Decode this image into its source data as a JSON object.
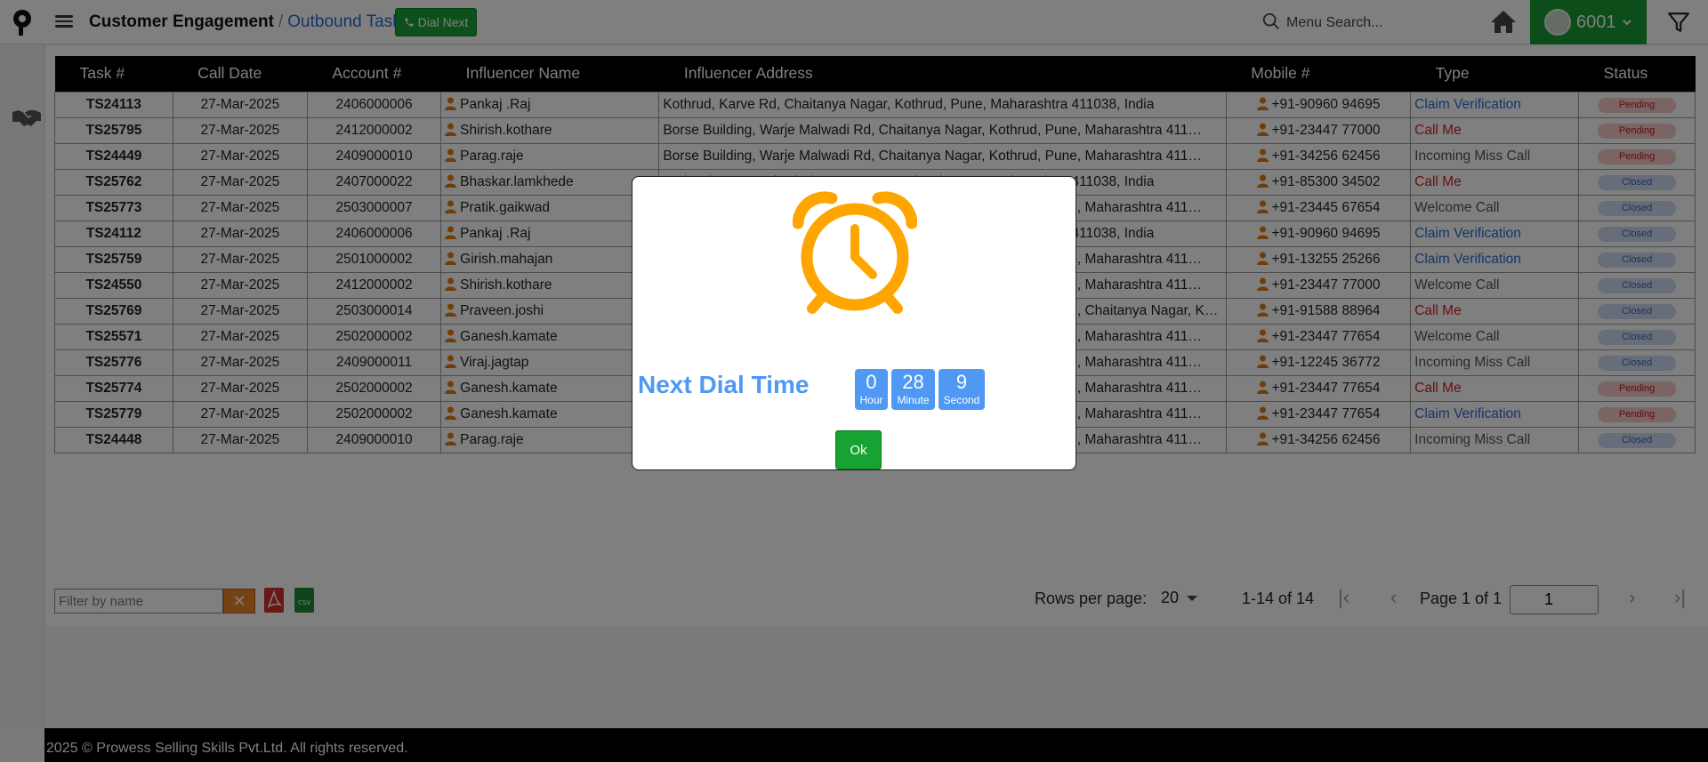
{
  "header": {
    "breadcrumb_root": "Customer Engagement",
    "breadcrumb_separator": "/",
    "breadcrumb_current": "Outbound Task",
    "dial_next_label": "Dial Next",
    "search_placeholder": "Menu Search...",
    "user_id": "6001"
  },
  "table": {
    "columns": [
      "Task #",
      "Call Date",
      "Account #",
      "Influencer Name",
      "Influencer Address",
      "Mobile #",
      "Type",
      "Status"
    ],
    "rows": [
      {
        "task": "TS24113",
        "date": "27-Mar-2025",
        "account": "2406000006",
        "name": "Pankaj .Raj",
        "address": "Kothrud, Karve Rd, Chaitanya Nagar, Kothrud, Pune, Maharashtra 411038, India",
        "mobile": "+91-90960 94695",
        "type": "Claim Verification",
        "type_color": "blue",
        "status": "Pending"
      },
      {
        "task": "TS25795",
        "date": "27-Mar-2025",
        "account": "2412000002",
        "name": "Shirish.kothare",
        "address": "Borse Building, Warje Malwadi Rd, Chaitanya Nagar, Kothrud, Pune, Maharashtra 411…",
        "mobile": "+91-23447 77000",
        "type": "Call Me",
        "type_color": "red",
        "status": "Pending"
      },
      {
        "task": "TS24449",
        "date": "27-Mar-2025",
        "account": "2409000010",
        "name": "Parag.raje",
        "address": "Borse Building, Warje Malwadi Rd, Chaitanya Nagar, Kothrud, Pune, Maharashtra 411…",
        "mobile": "+91-34256 62456",
        "type": "Incoming Miss Call",
        "type_color": "gray",
        "status": "Pending"
      },
      {
        "task": "TS25762",
        "date": "27-Mar-2025",
        "account": "2407000022",
        "name": "Bhaskar.lamkhede",
        "address": "Kothrud, Karve Rd, Chaitanya Nagar, Kothrud, Pune, Maharashtra 411038, India",
        "mobile": "+91-85300 34502",
        "type": "Call Me",
        "type_color": "red",
        "status": "Closed"
      },
      {
        "task": "TS25773",
        "date": "27-Mar-2025",
        "account": "2503000007",
        "name": "Pratik.gaikwad",
        "address": "Borse Building, Warje Malwadi Rd, Chaitanya Nagar, Kothrud, Pune, Maharashtra 411…",
        "mobile": "+91-23445 67654",
        "type": "Welcome Call",
        "type_color": "gray",
        "status": "Closed"
      },
      {
        "task": "TS24112",
        "date": "27-Mar-2025",
        "account": "2406000006",
        "name": "Pankaj .Raj",
        "address": "Kothrud, Karve Rd, Chaitanya Nagar, Kothrud, Pune, Maharashtra 411038, India",
        "mobile": "+91-90960 94695",
        "type": "Claim Verification",
        "type_color": "blue",
        "status": "Closed"
      },
      {
        "task": "TS25759",
        "date": "27-Mar-2025",
        "account": "2501000002",
        "name": "Girish.mahajan",
        "address": "Borse Building, Warje Malwadi Rd, Chaitanya Nagar, Kothrud, Pune, Maharashtra 411…",
        "mobile": "+91-13255 25266",
        "type": "Claim Verification",
        "type_color": "blue",
        "status": "Closed"
      },
      {
        "task": "TS24550",
        "date": "27-Mar-2025",
        "account": "2412000002",
        "name": "Shirish.kothare",
        "address": "Borse Building, Warje Malwadi Rd, Chaitanya Nagar, Kothrud, Pune, Maharashtra 411…",
        "mobile": "+91-23447 77000",
        "type": "Welcome Call",
        "type_color": "gray",
        "status": "Closed"
      },
      {
        "task": "TS25769",
        "date": "27-Mar-2025",
        "account": "2503000014",
        "name": "Praveen.joshi",
        "address": "Borse Building, Warje Malwadi Rd, Chaitanya Nagar, Kothrud, Pune, Chaitanya Nagar, Kothr…",
        "mobile": "+91-91588 88964",
        "type": "Call Me",
        "type_color": "red",
        "status": "Closed"
      },
      {
        "task": "TS25571",
        "date": "27-Mar-2025",
        "account": "2502000002",
        "name": "Ganesh.kamate",
        "address": "Borse Building, Warje Malwadi Rd, Chaitanya Nagar, Kothrud, Pune, Maharashtra 411…",
        "mobile": "+91-23447 77654",
        "type": "Welcome Call",
        "type_color": "gray",
        "status": "Closed"
      },
      {
        "task": "TS25776",
        "date": "27-Mar-2025",
        "account": "2409000011",
        "name": "Viraj.jagtap",
        "address": "Borse Building, Warje Malwadi Rd, Chaitanya Nagar, Kothrud, Pune, Maharashtra 411…",
        "mobile": "+91-12245 36772",
        "type": "Incoming Miss Call",
        "type_color": "gray",
        "status": "Closed"
      },
      {
        "task": "TS25774",
        "date": "27-Mar-2025",
        "account": "2502000002",
        "name": "Ganesh.kamate",
        "address": "Borse Building, Warje Malwadi Rd, Chaitanya Nagar, Kothrud, Pune, Maharashtra 411…",
        "mobile": "+91-23447 77654",
        "type": "Call Me",
        "type_color": "red",
        "status": "Pending"
      },
      {
        "task": "TS25779",
        "date": "27-Mar-2025",
        "account": "2502000002",
        "name": "Ganesh.kamate",
        "address": "Borse Building, Warje Malwadi Rd, Chaitanya Nagar, Kothrud, Pune, Maharashtra 411…",
        "mobile": "+91-23447 77654",
        "type": "Claim Verification",
        "type_color": "blue",
        "status": "Pending"
      },
      {
        "task": "TS24448",
        "date": "27-Mar-2025",
        "account": "2409000010",
        "name": "Parag.raje",
        "address": "Borse Building, Warje Malwadi Rd, Chaitanya Nagar, Kothrud, Pune, Maharashtra 411…",
        "mobile": "+91-34256 62456",
        "type": "Incoming Miss Call",
        "type_color": "gray",
        "status": "Closed"
      }
    ]
  },
  "toolbar": {
    "filter_placeholder": "Filter by name",
    "rows_per_page_label": "Rows per page:",
    "rows_per_page_value": "20",
    "range_text": "1-14 of 14",
    "page_label": "Page 1 of 1",
    "page_input_value": "1"
  },
  "modal": {
    "title": "Next Dial Time",
    "hour_value": "0",
    "hour_label": "Hour",
    "minute_value": "28",
    "minute_label": "Minute",
    "second_value": "9",
    "second_label": "Second",
    "ok_label": "Ok"
  },
  "footer": {
    "text": "2025 © Prowess Selling Skills Pvt.Ltd. All rights reserved."
  },
  "colors": {
    "accent_green": "#18a234",
    "link_blue": "#2a6bd1",
    "timer_blue": "#4f98f3",
    "alarm_orange": "#ffa500",
    "person_icon": "#e07a10"
  },
  "icons": [
    "logo-pin-icon",
    "menu-icon",
    "phone-icon",
    "search-icon",
    "home-icon",
    "avatar",
    "chevron-down-icon",
    "filter-icon",
    "handshake-icon",
    "person-icon",
    "pdf-icon",
    "csv-icon",
    "alarm-clock-icon",
    "first-page-icon",
    "prev-page-icon",
    "next-page-icon",
    "last-page-icon"
  ]
}
